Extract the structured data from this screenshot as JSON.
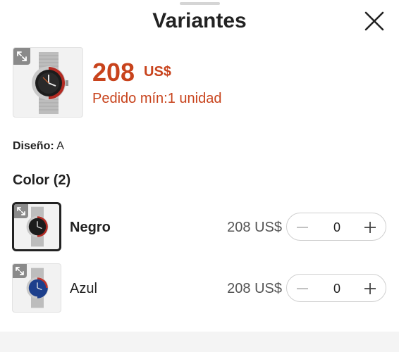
{
  "sheet": {
    "title": "Variantes"
  },
  "product": {
    "price_value": "208",
    "price_currency": "US$",
    "min_order": "Pedido mín:1 unidad"
  },
  "design": {
    "label": "Diseño:",
    "value": "A"
  },
  "color_section": {
    "heading": "Color (2)"
  },
  "variants": [
    {
      "name": "Negro",
      "price": "208 US$",
      "quantity": "0",
      "selected": true,
      "bezel_colors": [
        "#b32b23",
        "#1c1c1c"
      ]
    },
    {
      "name": "Azul",
      "price": "208 US$",
      "quantity": "0",
      "selected": false,
      "bezel_colors": [
        "#c0332a",
        "#1d3f8c"
      ]
    }
  ],
  "colors": {
    "accent": "#c8431c",
    "text": "#222222",
    "muted_text": "#555555",
    "border": "#cfcfcf"
  },
  "icons": [
    "close-icon",
    "expand-icon",
    "minus-icon",
    "plus-icon"
  ]
}
